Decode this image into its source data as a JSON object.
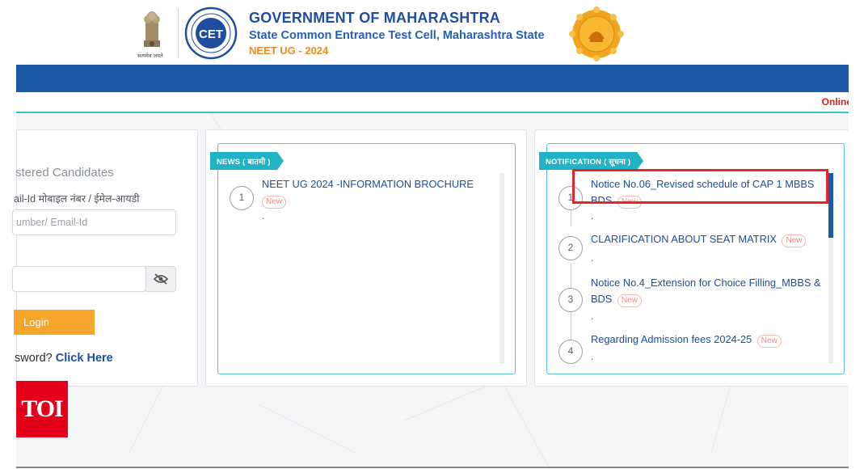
{
  "header": {
    "title": "GOVERNMENT OF MAHARASHTRA",
    "subtitle": "State Common Entrance Test Cell, Maharashtra State",
    "exam": "NEET UG - 2024",
    "emblem_caption": "सत्यमेव जयते",
    "cet_logo_text": "CET"
  },
  "ticker": {
    "text": "Online"
  },
  "login": {
    "heading": "stered Candidates",
    "user_label": "ail-Id मोबाइल नंबर / ईमेल-आयडी",
    "user_placeholder": "umber/ Email-Id",
    "password_value": "",
    "login_label": "Login",
    "forgot_prefix": "sword?",
    "forgot_link": "Click Here"
  },
  "news": {
    "tag": "NEWS ( बातमी )",
    "items": [
      {
        "num": "1",
        "title": "NEET UG 2024 -INFORMATION BROCHURE",
        "badge": "New",
        "dot": "."
      }
    ]
  },
  "notification": {
    "tag": "NOTIFICATION ( सूचना )",
    "items": [
      {
        "num": "1",
        "title": "Notice No.06_Revised schedule of CAP 1 MBBS BDS",
        "badge": "New",
        "dot": "."
      },
      {
        "num": "2",
        "title": "CLARIFICATION ABOUT SEAT MATRIX",
        "badge": "New",
        "dot": "."
      },
      {
        "num": "3",
        "title": "Notice No.4_Extension for Choice Filling_MBBS & BDS",
        "badge": "New",
        "dot": "."
      },
      {
        "num": "4",
        "title": "Regarding Admission fees 2024-25",
        "badge": "New",
        "dot": "."
      }
    ]
  },
  "watermark": {
    "text": "TOI"
  },
  "colors": {
    "brand_blue": "#1c5aa5",
    "accent_orange": "#f6a52b",
    "teal": "#21b2c3",
    "highlight_red": "#e3262b"
  }
}
